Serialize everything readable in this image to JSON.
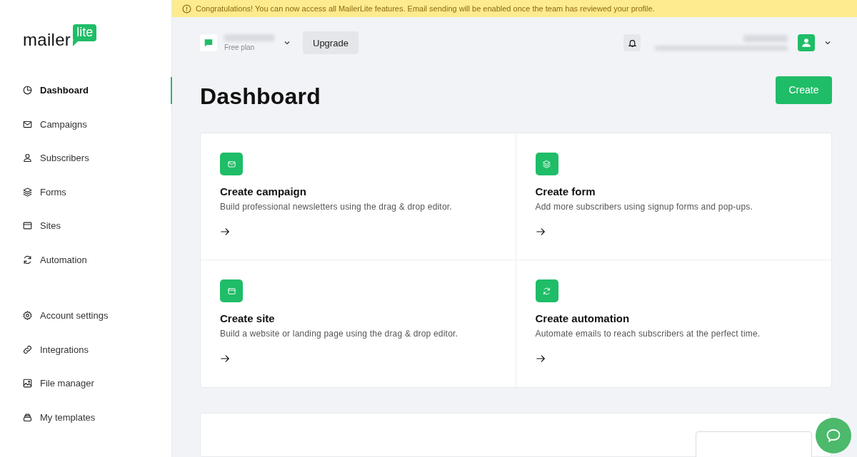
{
  "logo": {
    "word": "mailer",
    "badge": "lite"
  },
  "sidebar": {
    "items": [
      {
        "label": "Dashboard",
        "kind": "clock",
        "selected": true
      },
      {
        "label": "Campaigns",
        "kind": "mail",
        "selected": false
      },
      {
        "label": "Subscribers",
        "kind": "user",
        "selected": false
      },
      {
        "label": "Forms",
        "kind": "layers",
        "selected": false
      },
      {
        "label": "Sites",
        "kind": "window",
        "selected": false
      },
      {
        "label": "Automation",
        "kind": "refresh",
        "selected": false
      }
    ],
    "bottom_items": [
      {
        "label": "Account settings",
        "kind": "gear",
        "selected": false
      },
      {
        "label": "Integrations",
        "kind": "link",
        "selected": false
      },
      {
        "label": "File manager",
        "kind": "image",
        "selected": false
      },
      {
        "label": "My templates",
        "kind": "stack",
        "selected": false
      }
    ]
  },
  "banner": {
    "text": "Congratulations! You can now access all MailerLite features. Email sending will be enabled once the team has reviewed your profile."
  },
  "topbar": {
    "account_plan": "Free plan",
    "upgrade": "Upgrade"
  },
  "page": {
    "title": "Dashboard",
    "create": "Create"
  },
  "cards": [
    {
      "title": "Create campaign",
      "description": "Build professional newsletters using the drag & drop editor.",
      "kind": "mail"
    },
    {
      "title": "Create form",
      "description": "Add more subscribers using signup forms and pop-ups.",
      "kind": "layers"
    },
    {
      "title": "Create site",
      "description": "Build a website or landing page using the drag & drop editor.",
      "kind": "window"
    },
    {
      "title": "Create automation",
      "description": "Automate emails to reach subscribers at the perfect time.",
      "kind": "refresh"
    }
  ]
}
